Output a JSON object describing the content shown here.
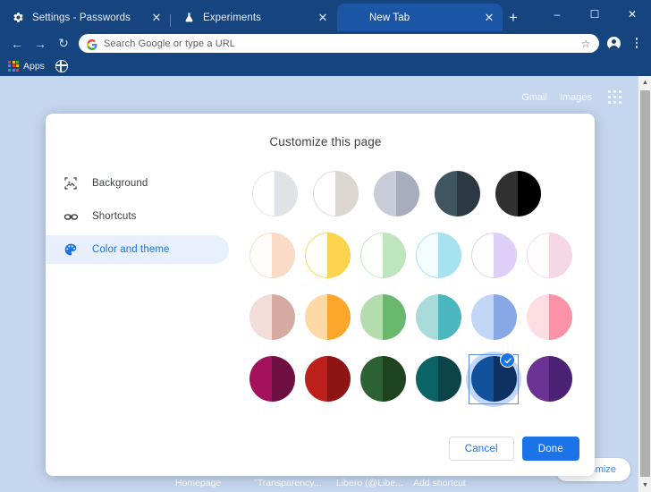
{
  "window": {
    "minimize_label": "–",
    "maximize_label": "☐",
    "close_label": "✕"
  },
  "tabs": [
    {
      "title": "Settings - Passwords",
      "icon": "gear-icon",
      "active": false,
      "close_label": "✕"
    },
    {
      "title": "Experiments",
      "icon": "flask-icon",
      "active": false,
      "close_label": "✕"
    },
    {
      "title": "New Tab",
      "icon": "none",
      "active": true,
      "close_label": "✕"
    }
  ],
  "newtab_button_label": "+",
  "toolbar": {
    "back_label": "←",
    "forward_label": "→",
    "reload_label": "↻",
    "omnibox_text": "Search Google or type a URL",
    "omnibox_placeholder": "Search Google or type a URL",
    "star_label": "☆",
    "profile_name": "profile-icon",
    "menu_name": "kebab-menu-icon"
  },
  "bookmarks": {
    "apps_label": "Apps",
    "second_item_name": "globe-bookmark-icon"
  },
  "ntp": {
    "links": [
      "Gmail",
      "Images"
    ],
    "apps_grid_name": "google-apps-grid-icon",
    "shortcuts": [
      "Homepage",
      "\"Transparency...",
      "Libero (@Libe...",
      "Add shortcut"
    ],
    "customize_label": "Customize"
  },
  "scrollbar": {
    "up_arrow": "▲",
    "down_arrow": "▼"
  },
  "dialog": {
    "title": "Customize this page",
    "sidebar": [
      {
        "label": "Background",
        "icon": "image-icon",
        "selected": false
      },
      {
        "label": "Shortcuts",
        "icon": "link-icon",
        "selected": false
      },
      {
        "label": "Color and theme",
        "icon": "palette-icon",
        "selected": true
      }
    ],
    "buttons": {
      "cancel": "Cancel",
      "done": "Done"
    },
    "selected_swatch": {
      "row": 3,
      "col": 4
    },
    "accent_color": "#1a73e8",
    "swatch_rows": [
      [
        {
          "name": "default-white",
          "light": "#ffffff",
          "dark": "#dfe2e7",
          "outlined": true
        },
        {
          "name": "warm-grey",
          "light": "#ffffff",
          "dark": "#dcd6d1",
          "outlined": true
        },
        {
          "name": "cool-grey",
          "light": "#c8ccd6",
          "dark": "#a7adbd",
          "outlined": false
        },
        {
          "name": "slate",
          "light": "#3f5560",
          "dark": "#2b3a42",
          "outlined": false
        },
        {
          "name": "black",
          "light": "#303030",
          "dark": "#000000",
          "outlined": false
        }
      ],
      [
        {
          "name": "pale-peach",
          "light": "#fffdfc",
          "dark": "#fadbc8",
          "outlined": true
        },
        {
          "name": "pale-yellow",
          "light": "#ffffff",
          "dark": "#fbd34d",
          "outlined": true
        },
        {
          "name": "pale-green",
          "light": "#fdfffd",
          "dark": "#bfe5be",
          "outlined": true
        },
        {
          "name": "pale-cyan",
          "light": "#f4fdff",
          "dark": "#a6e2f0",
          "outlined": true
        },
        {
          "name": "pale-purple",
          "light": "#fffeff",
          "dark": "#ddcff7",
          "outlined": true
        },
        {
          "name": "pale-pink",
          "light": "#fffdfe",
          "dark": "#f6d7e5",
          "outlined": true
        }
      ],
      [
        {
          "name": "dusty-rose",
          "light": "#f2ddd8",
          "dark": "#d7aaa1",
          "outlined": false
        },
        {
          "name": "orange",
          "light": "#fdd9a5",
          "dark": "#fca62b",
          "outlined": false
        },
        {
          "name": "green",
          "light": "#b4ddaf",
          "dark": "#69b86e",
          "outlined": false
        },
        {
          "name": "teal",
          "light": "#a9dbdb",
          "dark": "#4bb6bd",
          "outlined": false
        },
        {
          "name": "blue",
          "light": "#c2d6f5",
          "dark": "#86a9e6",
          "outlined": false
        },
        {
          "name": "pink",
          "light": "#fcdde2",
          "dark": "#fb93a8",
          "outlined": false
        }
      ],
      [
        {
          "name": "magenta",
          "light": "#a3115c",
          "dark": "#6f0f41",
          "outlined": false
        },
        {
          "name": "red",
          "light": "#bc1f1c",
          "dark": "#8d1513",
          "outlined": false
        },
        {
          "name": "forest-green",
          "light": "#2c6233",
          "dark": "#1d441f",
          "outlined": false
        },
        {
          "name": "dark-teal",
          "light": "#0b6366",
          "dark": "#0a4449",
          "outlined": false
        },
        {
          "name": "dark-blue",
          "light": "#12519b",
          "dark": "#0f3162",
          "outlined": false
        },
        {
          "name": "purple",
          "light": "#6a3394",
          "dark": "#4b2174",
          "outlined": false
        }
      ]
    ]
  }
}
